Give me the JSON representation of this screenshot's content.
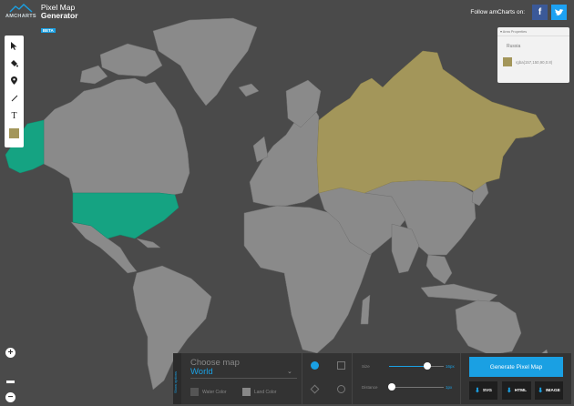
{
  "header": {
    "brand": "AMCHARTS",
    "title_line1": "Pixel Map",
    "title_line2": "Generator",
    "badge": "BETA",
    "follow_text": "Follow amCharts on:",
    "facebook_icon": "facebook-icon",
    "twitter_icon": "twitter-icon"
  },
  "tools": [
    {
      "name": "pointer-tool",
      "icon": "cursor-arrow-icon",
      "glyph": "➤"
    },
    {
      "name": "fill-tool",
      "icon": "paint-bucket-icon",
      "glyph": "◆"
    },
    {
      "name": "marker-tool",
      "icon": "map-pin-icon",
      "glyph": "⬤"
    },
    {
      "name": "line-tool",
      "icon": "line-icon",
      "glyph": "╱"
    },
    {
      "name": "text-tool",
      "icon": "text-icon",
      "glyph": "T"
    },
    {
      "name": "color-tool",
      "icon": "color-swatch-icon",
      "glyph": ""
    }
  ],
  "area_properties": {
    "heading": "Area Properties",
    "name": "Russia",
    "color_value": "rgba(157,150,90,0.8)"
  },
  "colors": {
    "background": "#4a4a4a",
    "land": "#8a8a8a",
    "selected_green": "#15a382",
    "selected_olive": "#a3965a",
    "accent": "#1aa0e3"
  },
  "zoom": {
    "in_label": "+",
    "out_label": "−"
  },
  "panel": {
    "handle_text": "Show options",
    "choose_label": "Choose map",
    "selected_map": "World",
    "water_color_label": "Water Color",
    "land_color_label": "Land Color",
    "size_label": "Size",
    "size_value": "16px",
    "size_level": 0.7,
    "distance_label": "Distance",
    "distance_value": "1px",
    "distance_level": 0.05,
    "generate_label": "Generate Pixel Map",
    "svg_label": "SVG",
    "html_label": "HTML",
    "image_label": "IMAGE"
  }
}
